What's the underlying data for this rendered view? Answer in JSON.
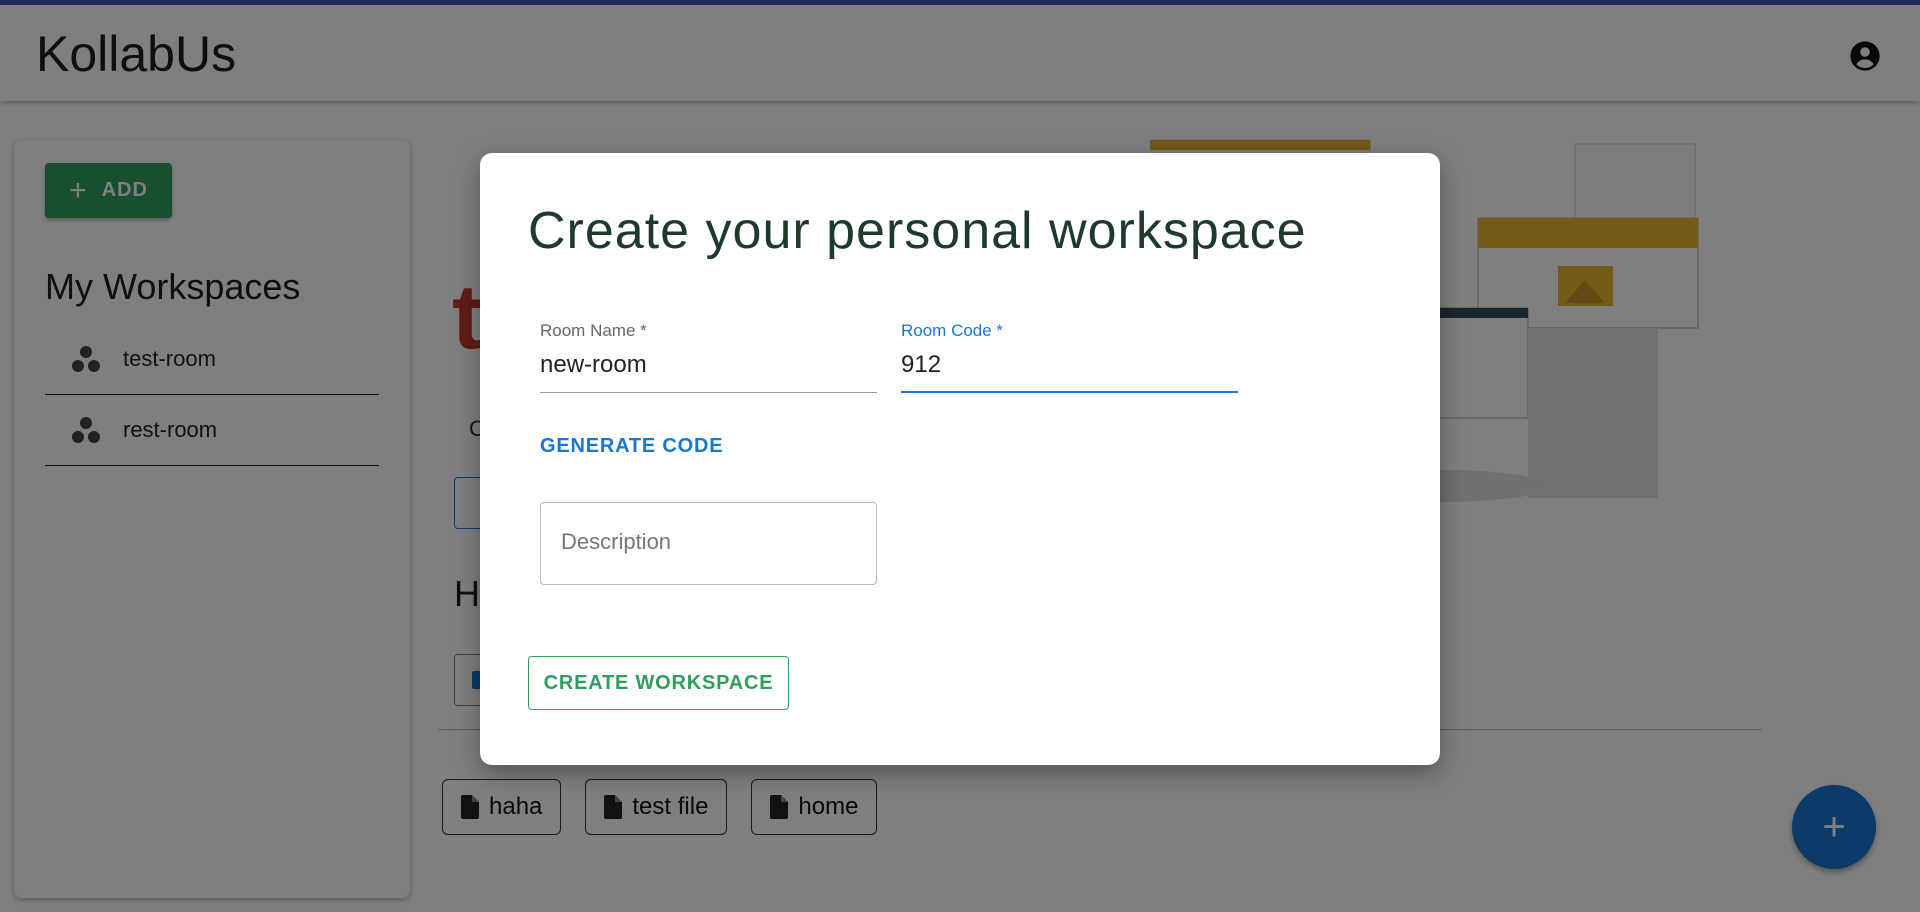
{
  "app": {
    "brand": "KollabUs"
  },
  "sidebar": {
    "add_label": "ADD",
    "heading": "My Workspaces",
    "items": [
      {
        "label": "test-room",
        "icon": "workspaces-icon"
      },
      {
        "label": "rest-room",
        "icon": "workspaces-icon"
      }
    ]
  },
  "background": {
    "title_fragment": "t",
    "sub_fragment": "C",
    "heading_fragment": "H",
    "files": [
      "haha",
      "test file",
      "home"
    ]
  },
  "dialog": {
    "title": "Create your personal workspace",
    "room_name": {
      "label": "Room Name *",
      "value": "new-room"
    },
    "room_code": {
      "label": "Room Code *",
      "value": "912"
    },
    "generate_label": "GENERATE CODE",
    "description_placeholder": "Description",
    "create_label": "CREATE WORKSPACE"
  },
  "colors": {
    "primary": "#1976d2",
    "success": "#2e9e5e",
    "accent": "#c0392b"
  }
}
